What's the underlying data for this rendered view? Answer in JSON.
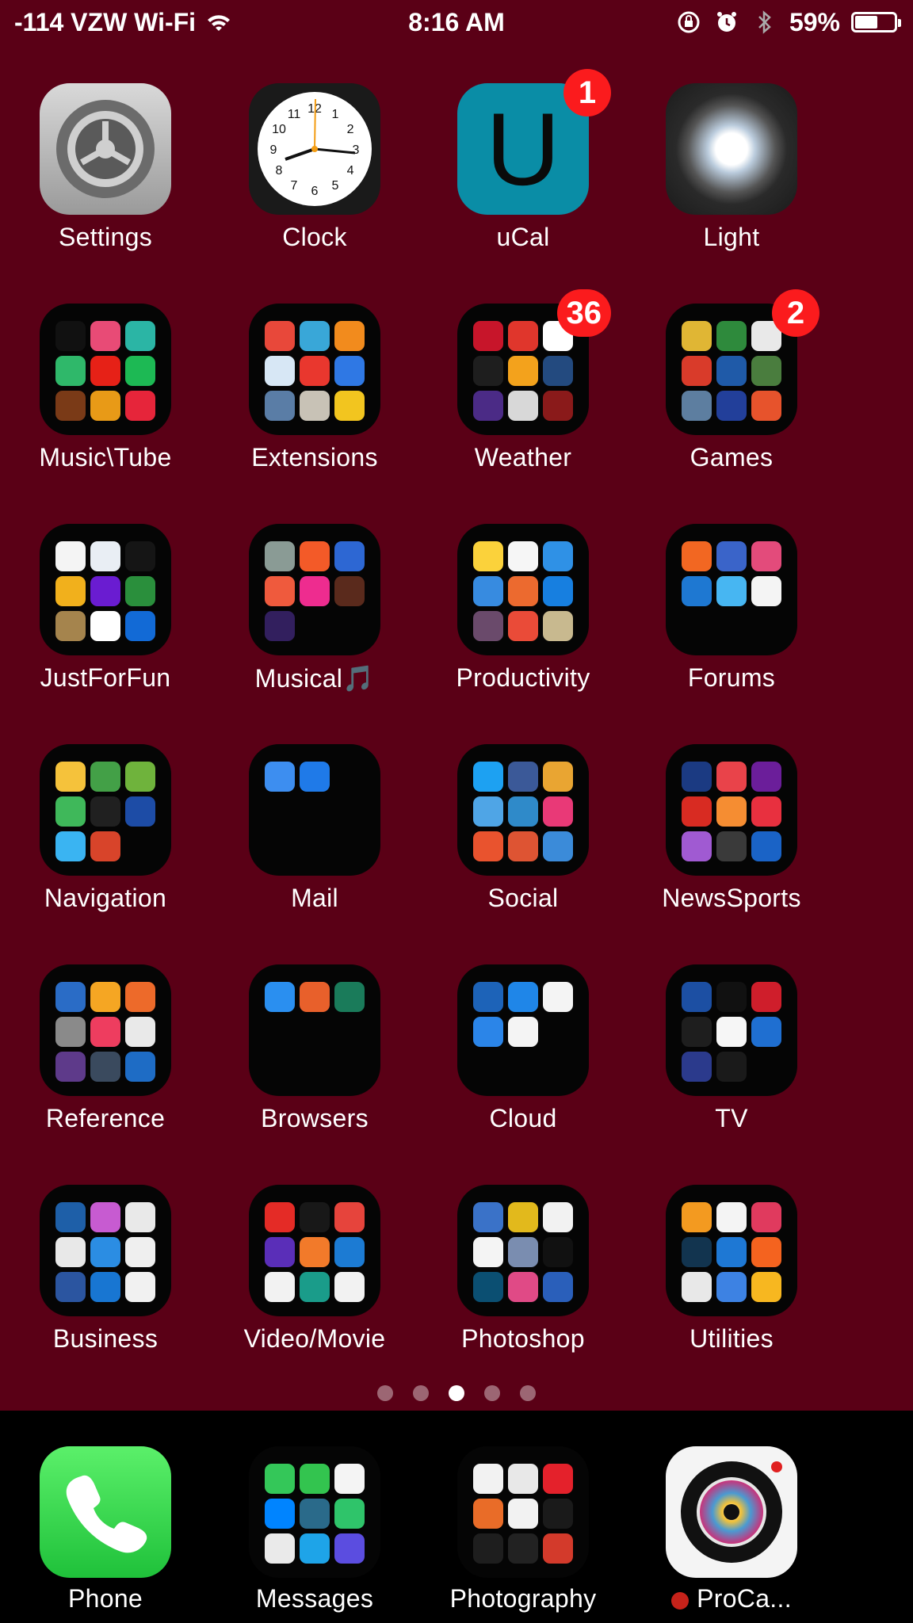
{
  "status": {
    "carrier": "-114 VZW Wi-Fi",
    "time": "8:16 AM",
    "battery": "59%",
    "battery_level": 0.59,
    "icons": [
      "wifi-icon",
      "orientation-lock-icon",
      "alarm-icon",
      "bluetooth-icon",
      "battery-icon"
    ]
  },
  "rows": [
    [
      {
        "label": "Settings",
        "type": "settings"
      },
      {
        "label": "Clock",
        "type": "clock"
      },
      {
        "label": "uCal",
        "type": "ucal",
        "glyph": "U",
        "badge": "1"
      },
      {
        "label": "Light",
        "type": "light"
      }
    ],
    [
      {
        "label": "Music\\Tube",
        "type": "folder",
        "colors": [
          "#111",
          "#e84b76",
          "#2bb5a5",
          "#2fb86a",
          "#e62117",
          "#1db954",
          "#7a3a17",
          "#e89a17",
          "#e6253a"
        ]
      },
      {
        "label": "Extensions",
        "type": "folder",
        "colors": [
          "#e8483a",
          "#39a7d8",
          "#f28b1d",
          "#d7e7f5",
          "#e9372e",
          "#2f78e4",
          "#5a7da6",
          "#c8c2b6",
          "#f2c51f"
        ]
      },
      {
        "label": "Weather",
        "type": "folder",
        "badge": "36",
        "colors": [
          "#c7152a",
          "#e0362c",
          "#fff",
          "#1e1e1e",
          "#f3a21c",
          "#234a7f",
          "#4b2b86",
          "#d8d8d8",
          "#8a1a1a"
        ]
      },
      {
        "label": "Games",
        "type": "folder",
        "badge": "2",
        "colors": [
          "#e0b634",
          "#2e8a3c",
          "#e9e9e9",
          "#d93b2a",
          "#1f5aa8",
          "#4a7d3e",
          "#5d7ea0",
          "#223f9a",
          "#e7532c"
        ]
      }
    ],
    [
      {
        "label": "JustForFun",
        "type": "folder",
        "colors": [
          "#f4f4f4",
          "#e9eef4",
          "#151515",
          "#f1b01c",
          "#6a1cd1",
          "#2a8f3c",
          "#a5844d",
          "#fff",
          "#126ad6"
        ]
      },
      {
        "label": "Musical🎵",
        "type": "folder",
        "colors": [
          "#8a9b95",
          "#f35a28",
          "#2d67d3",
          "#ef5a3d",
          "#ee2c8f",
          "#5a2a1c",
          "#321f5e"
        ]
      },
      {
        "label": "Productivity",
        "type": "folder",
        "colors": [
          "#fbd23b",
          "#f6f6f6",
          "#2f91e6",
          "#378be0",
          "#ec6a2f",
          "#177fe0",
          "#6a4a6b",
          "#ea4b38",
          "#c8b98f"
        ]
      },
      {
        "label": "Forums",
        "type": "folder",
        "colors": [
          "#f26722",
          "#3a64c9",
          "#e34b7b",
          "#1e78d2",
          "#47b6f2",
          "#f4f4f4"
        ]
      }
    ],
    [
      {
        "label": "Navigation",
        "type": "folder",
        "colors": [
          "#f5c23b",
          "#43a047",
          "#6fb33c",
          "#3fb85a",
          "#202020",
          "#1d4ca6",
          "#3ab4f2",
          "#d8442a"
        ]
      },
      {
        "label": "Mail",
        "type": "folder",
        "colors": [
          "#3d8ef0",
          "#1f7ae8"
        ]
      },
      {
        "label": "Social",
        "type": "folder",
        "colors": [
          "#1da1f2",
          "#3b5998",
          "#e9a532",
          "#4fa5e6",
          "#2f8ac9",
          "#e93977",
          "#e9532e",
          "#de5433",
          "#3b8bd9"
        ]
      },
      {
        "label": "NewsSports",
        "type": "folder",
        "colors": [
          "#1b3a82",
          "#e9434a",
          "#6b1e9a",
          "#d82b22",
          "#f58d32",
          "#e8303f",
          "#a05ad2",
          "#3a3a3a",
          "#1a63c6"
        ]
      }
    ],
    [
      {
        "label": "Reference",
        "type": "folder",
        "colors": [
          "#2a6cc6",
          "#f5a623",
          "#ed6a2a",
          "#8a8a8a",
          "#ee3d5f",
          "#e9e9e9",
          "#5e3a8a",
          "#3a4a5e",
          "#1e6cc5"
        ]
      },
      {
        "label": "Browsers",
        "type": "folder",
        "colors": [
          "#2a8ff0",
          "#e8602b",
          "#1a7b5a"
        ]
      },
      {
        "label": "Cloud",
        "type": "folder",
        "colors": [
          "#1d63b8",
          "#1f86e8",
          "#f4f4f4",
          "#2b85e8",
          "#f4f4f4"
        ]
      },
      {
        "label": "TV",
        "type": "folder",
        "colors": [
          "#1c4fa3",
          "#111",
          "#cf1e2b",
          "#1e1e1e",
          "#f6f6f6",
          "#1f6fd1",
          "#2b3a8c",
          "#1a1a1a"
        ]
      }
    ],
    [
      {
        "label": "Business",
        "type": "folder",
        "colors": [
          "#1e5fa8",
          "#c75bd1",
          "#e9e9e9",
          "#e8e8e8",
          "#2b8de3",
          "#efefef",
          "#2b55a0",
          "#1876d2",
          "#f1f1f1"
        ]
      },
      {
        "label": "Video/Movie",
        "type": "folder",
        "colors": [
          "#e42b26",
          "#181818",
          "#e6443c",
          "#5a2eb8",
          "#f27a2a",
          "#1c7bd3",
          "#f2f2f2",
          "#1a9c8a",
          "#f2f2f2"
        ]
      },
      {
        "label": "Photoshop",
        "type": "folder",
        "colors": [
          "#3a72c8",
          "#e2b91c",
          "#f2f2f2",
          "#f4f4f4",
          "#7a8db0",
          "#111",
          "#0b4f72",
          "#e04a86",
          "#2a5fba"
        ]
      },
      {
        "label": "Utilities",
        "type": "folder",
        "colors": [
          "#f39a20",
          "#f4f4f4",
          "#e03a5e",
          "#12344f",
          "#1e78d4",
          "#f4631f",
          "#e8e8e8",
          "#3d82e3",
          "#f7b720"
        ]
      }
    ]
  ],
  "page_dots": {
    "count": 5,
    "active": 2
  },
  "dock": [
    {
      "label": "Phone",
      "type": "phone"
    },
    {
      "label": "Messages",
      "type": "folder",
      "colors": [
        "#34c759",
        "#33c44f",
        "#f4f4f4",
        "#0084ff",
        "#2a6a8a",
        "#2fc46a",
        "#eaeaea",
        "#1ea4e8",
        "#5b4de0"
      ]
    },
    {
      "label": "Photography",
      "type": "folder",
      "colors": [
        "#f2f2f2",
        "#e8e8e8",
        "#e4212b",
        "#e96c28",
        "#f2f2f2",
        "#1a1a1a",
        "#1e1e1e",
        "#222",
        "#d33a2b"
      ]
    },
    {
      "label": "ProCa...",
      "type": "procamera",
      "dot": true
    }
  ]
}
